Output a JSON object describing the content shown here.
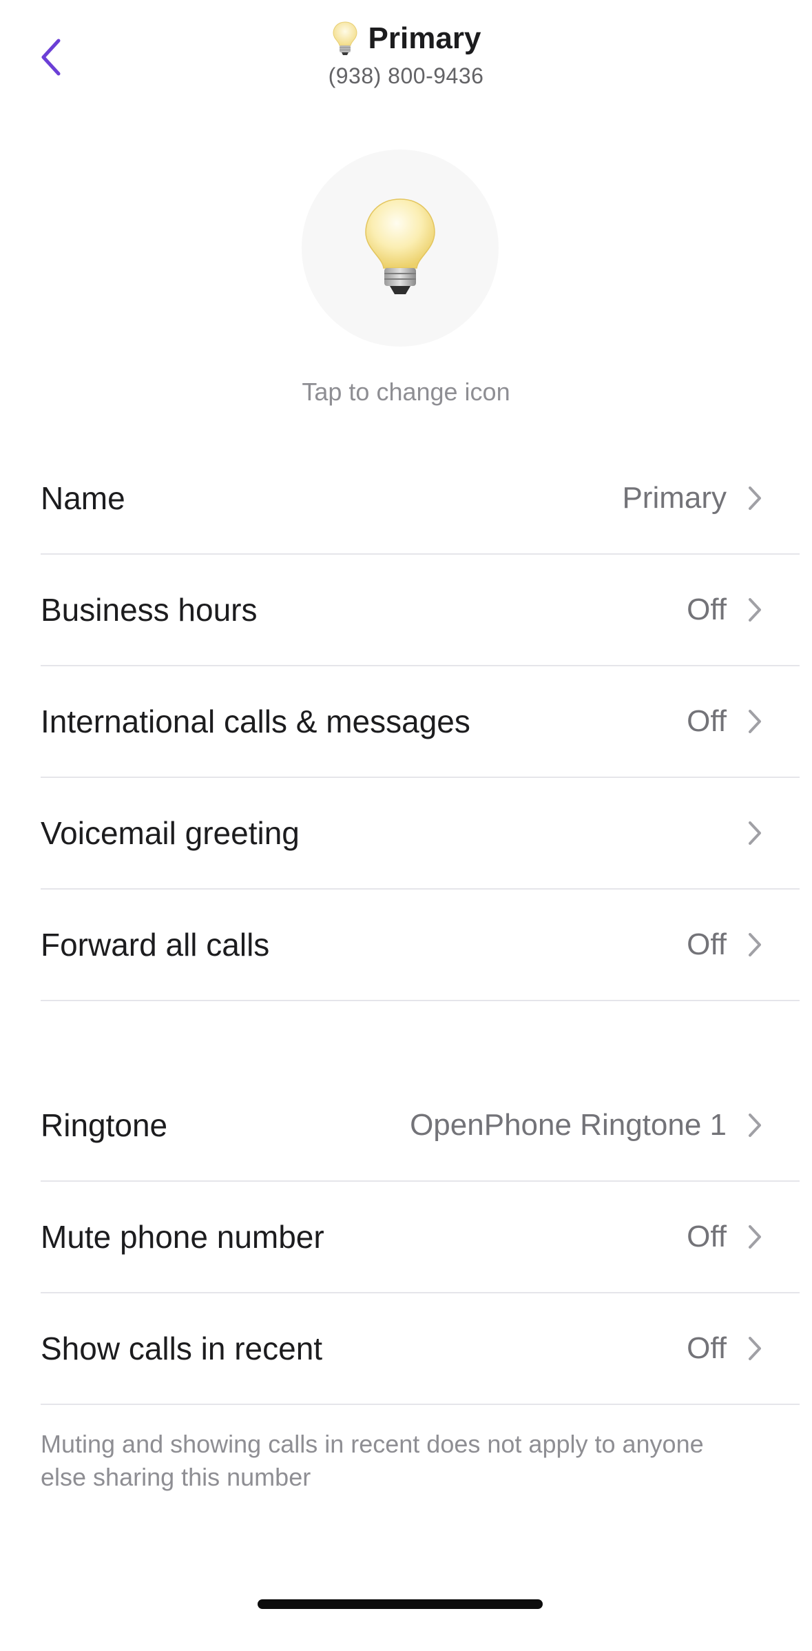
{
  "header": {
    "title": "Primary",
    "subtitle": "(938) 800-9436",
    "icon": "light-bulb-emoji",
    "back_icon": "chevron-left-icon"
  },
  "icon_picker": {
    "icon": "light-bulb-emoji",
    "hint": "Tap to change icon"
  },
  "settings": [
    {
      "label": "Name",
      "value": "Primary"
    },
    {
      "label": "Business hours",
      "value": "Off"
    },
    {
      "label": "International calls & messages",
      "value": "Off"
    },
    {
      "label": "Voicemail greeting",
      "value": ""
    },
    {
      "label": "Forward all calls",
      "value": "Off"
    }
  ],
  "preferences": [
    {
      "label": "Ringtone",
      "value": "OpenPhone Ringtone 1"
    },
    {
      "label": "Mute phone number",
      "value": "Off"
    },
    {
      "label": "Show calls in recent",
      "value": "Off"
    }
  ],
  "footnote": "Muting and showing calls in recent does not apply to anyone else sharing this number",
  "colors": {
    "accent": "#6b3fd6",
    "label": "#1c1c1e",
    "value": "#737378",
    "divider": "#e5e5ea",
    "icon_bg": "#f7f7f7"
  }
}
